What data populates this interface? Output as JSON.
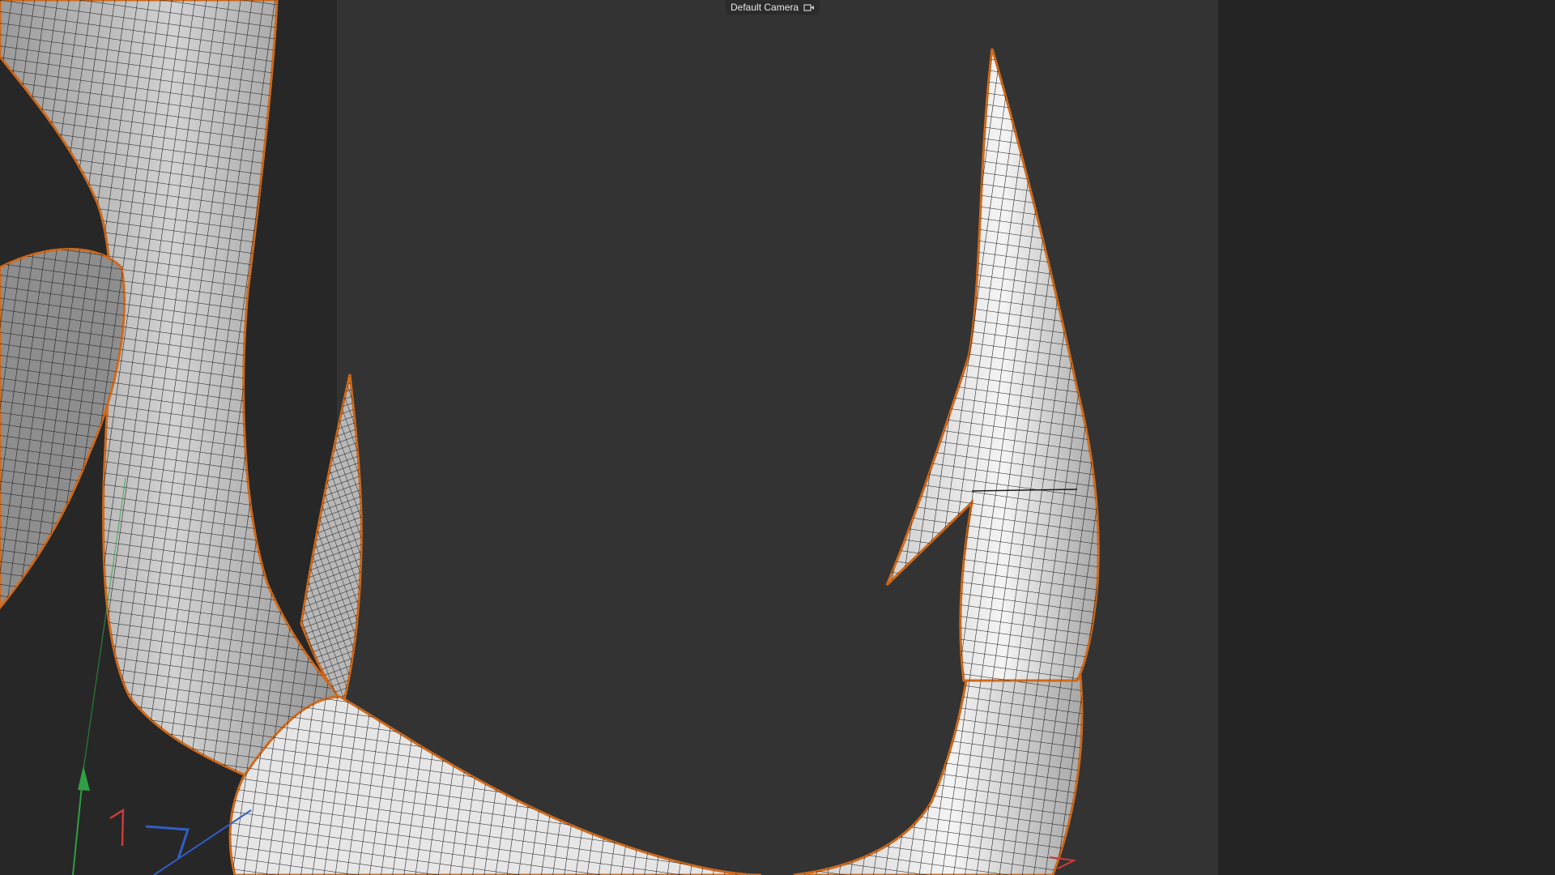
{
  "viewport": {
    "camera_label": "Default Camera",
    "camera_icon": "camera-icon",
    "object": "fish-hook-mesh",
    "display_mode": "shaded-wireframe",
    "selection_outline_color": "#d06a1c",
    "frame_color": "#333333",
    "outside_frame_color": "#272727",
    "axis_colors": {
      "x": "#d23a3a",
      "y": "#2ea043",
      "z": "#2f5fc4"
    }
  }
}
